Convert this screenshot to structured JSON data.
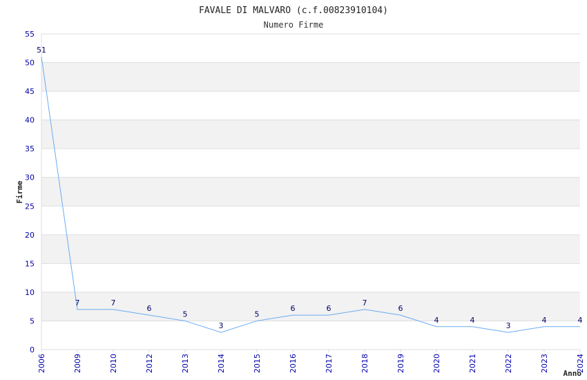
{
  "chart_data": {
    "type": "line",
    "title": "FAVALE DI MALVARO (c.f.00823910104)",
    "subtitle": "Numero Firme",
    "xlabel": "Anno",
    "ylabel": "Firme",
    "categories": [
      "2006",
      "2009",
      "2010",
      "2012",
      "2013",
      "2014",
      "2015",
      "2016",
      "2017",
      "2018",
      "2019",
      "2020",
      "2021",
      "2022",
      "2023",
      "2024"
    ],
    "values": [
      51,
      7,
      7,
      6,
      5,
      3,
      5,
      6,
      6,
      7,
      6,
      4,
      4,
      3,
      4,
      4
    ],
    "ylim": [
      0,
      55
    ],
    "yticks": [
      "0",
      "5",
      "10",
      "15",
      "20",
      "25",
      "30",
      "35",
      "40",
      "45",
      "50",
      "55"
    ],
    "grid": true,
    "colors": {
      "line": "#6aaaf0",
      "band": "#f2f2f2",
      "grid": "#dddddd",
      "tick": "#0000aa"
    }
  }
}
